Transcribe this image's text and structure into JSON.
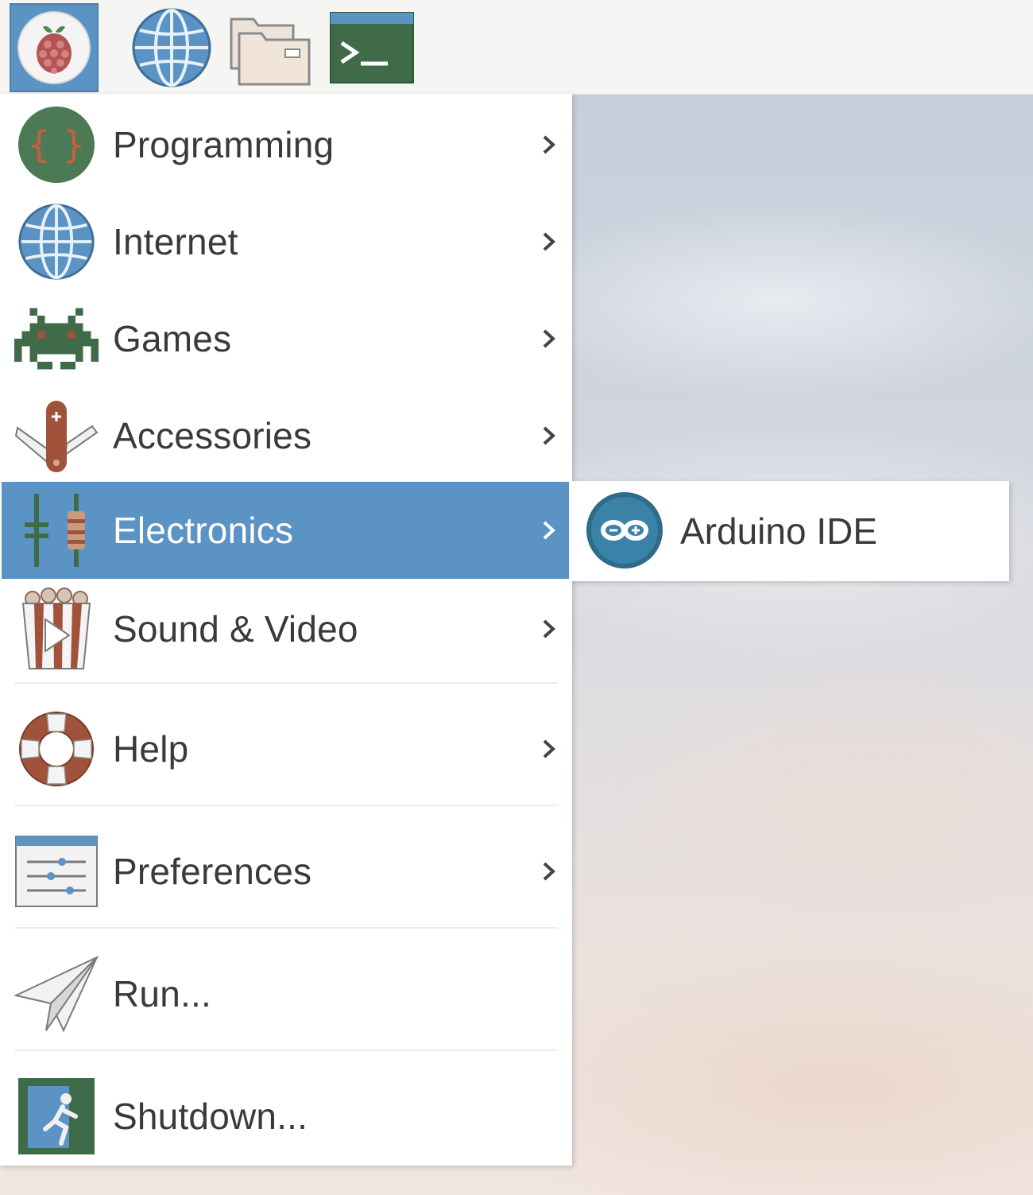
{
  "taskbar": {
    "buttons": [
      {
        "icon": "raspberry-icon",
        "active": true
      },
      {
        "icon": "globe-icon",
        "active": false
      },
      {
        "icon": "folders-icon",
        "active": false
      },
      {
        "icon": "terminal-icon",
        "active": false
      }
    ]
  },
  "menu": {
    "items": [
      {
        "label": "Programming",
        "icon": "braces-icon",
        "submenu": true
      },
      {
        "label": "Internet",
        "icon": "globe-icon",
        "submenu": true
      },
      {
        "label": "Games",
        "icon": "space-invader-icon",
        "submenu": true
      },
      {
        "label": "Accessories",
        "icon": "pocket-knife-icon",
        "submenu": true
      },
      {
        "label": "Electronics",
        "icon": "electronics-components-icon",
        "submenu": true,
        "selected": true
      },
      {
        "label": "Sound & Video",
        "icon": "popcorn-play-icon",
        "submenu": true
      },
      {
        "label": "Help",
        "icon": "lifebuoy-icon",
        "submenu": true
      },
      {
        "label": "Preferences",
        "icon": "settings-sliders-icon",
        "submenu": true
      },
      {
        "label": "Run...",
        "icon": "paper-plane-icon",
        "submenu": false
      },
      {
        "label": "Shutdown...",
        "icon": "exit-icon",
        "submenu": false
      }
    ]
  },
  "submenu": {
    "items": [
      {
        "label": "Arduino IDE",
        "icon": "arduino-icon"
      }
    ]
  },
  "colors": {
    "accent": "#5b93c4",
    "icon_green": "#4c7a55",
    "icon_brown": "#a0533a",
    "text": "#3a3a3a"
  }
}
